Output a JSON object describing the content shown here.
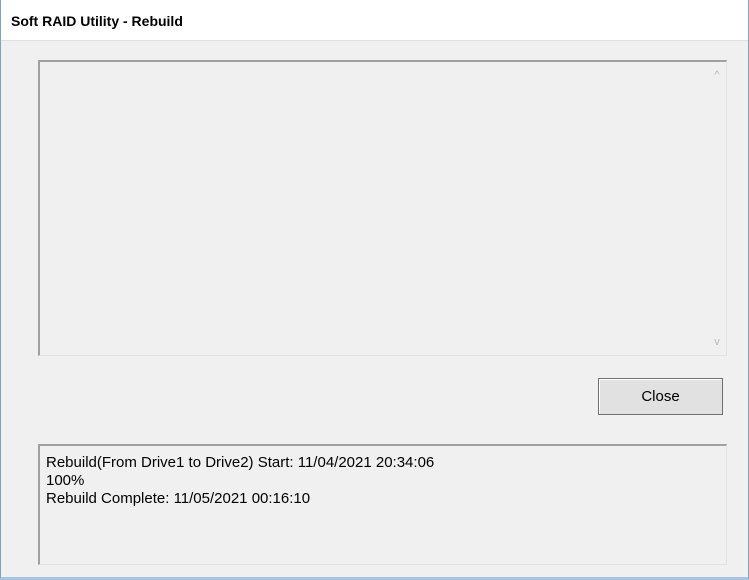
{
  "window": {
    "title": "Soft RAID Utility - Rebuild"
  },
  "log": {
    "scroll_up_glyph": "^",
    "scroll_down_glyph": "v"
  },
  "buttons": {
    "close_label": "Close"
  },
  "status": {
    "lines": [
      "Rebuild(From Drive1 to Drive2) Start: 11/04/2021 20:34:06",
      "100%",
      "Rebuild Complete: 11/05/2021 00:16:10"
    ]
  }
}
